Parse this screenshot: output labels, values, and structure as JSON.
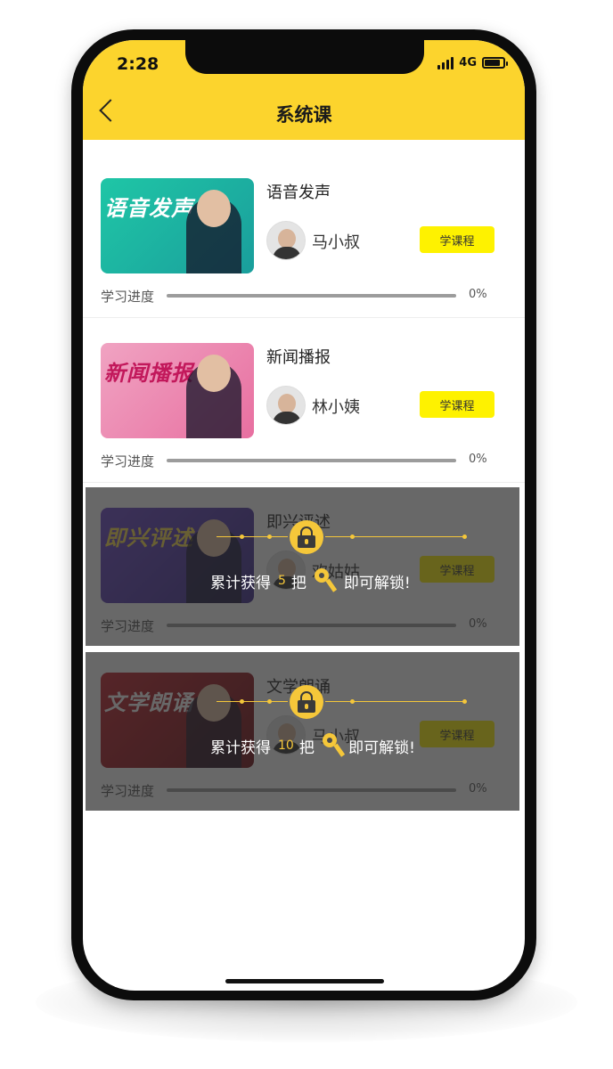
{
  "status_bar": {
    "time": "2:28",
    "network": "4G",
    "battery_level": 0.85
  },
  "header": {
    "title": "系统课"
  },
  "colors": {
    "brand_yellow": "#fcd42d",
    "button_yellow": "#fef200",
    "lock_gold": "#f5c73a"
  },
  "courses": [
    {
      "title": "语音发声",
      "thumb_text": "语音发声",
      "thumb_colors": [
        "#1fc6a6",
        "#1a9e9c"
      ],
      "thumb_text_color": "#ffffff",
      "teacher": "马小叔",
      "button": "学课程",
      "progress_label": "学习进度",
      "progress": 0,
      "progress_text": "0%",
      "locked": false
    },
    {
      "title": "新闻播报",
      "thumb_text": "新闻播报",
      "thumb_colors": [
        "#f0a3c2",
        "#e86fa0"
      ],
      "thumb_text_color": "#c2185b",
      "teacher": "林小姨",
      "button": "学课程",
      "progress_label": "学习进度",
      "progress": 0,
      "progress_text": "0%",
      "locked": false
    },
    {
      "title": "即兴评述",
      "thumb_text": "即兴评述",
      "thumb_colors": [
        "#6a46c8",
        "#3b2a8c"
      ],
      "thumb_text_color": "#ffe14d",
      "teacher": "欢姑姑",
      "button": "学课程",
      "progress_label": "学习进度",
      "progress": 0,
      "progress_text": "0%",
      "locked": true,
      "unlock": {
        "prefix": "累计获得",
        "keys": "5",
        "unit": "把",
        "suffix": "即可解锁!"
      }
    },
    {
      "title": "文学朗诵",
      "thumb_text": "文学朗诵",
      "thumb_colors": [
        "#c21f2a",
        "#6e0c12"
      ],
      "thumb_text_color": "#ffffff",
      "teacher": "马小叔",
      "button": "学课程",
      "progress_label": "学习进度",
      "progress": 0,
      "progress_text": "0%",
      "locked": true,
      "unlock": {
        "prefix": "累计获得",
        "keys": "10",
        "unit": "把",
        "suffix": "即可解锁!"
      }
    }
  ]
}
